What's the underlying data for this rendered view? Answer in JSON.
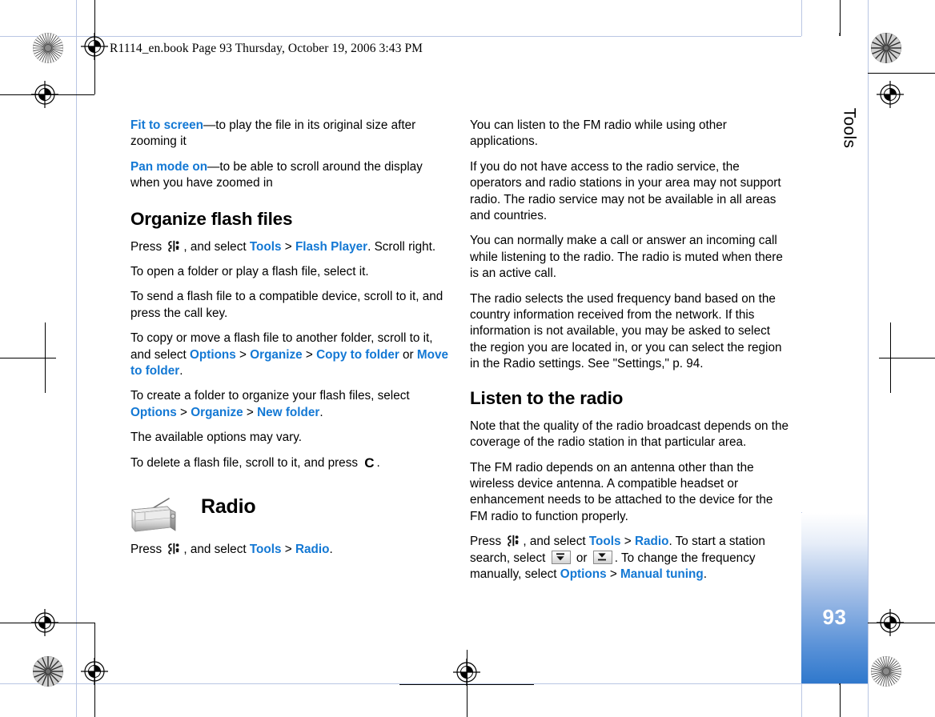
{
  "document": {
    "header_line": "R1114_en.book  Page 93  Thursday, October 19, 2006  3:43 PM",
    "page_number": "93",
    "section_tab": "Tools",
    "accent_color": "#1378d4",
    "page_tab_gradient_end": "#2f78cc"
  },
  "left_column": {
    "paragraphs": [
      {
        "id": "fit-to-screen",
        "segments": [
          {
            "type": "link",
            "text": "Fit to screen"
          },
          {
            "type": "text",
            "text": "—to play the file in its original size after zooming it"
          }
        ]
      },
      {
        "id": "pan-mode-on",
        "segments": [
          {
            "type": "link",
            "text": "Pan mode on"
          },
          {
            "type": "text",
            "text": "—to be able to scroll around the display when you have zoomed in"
          }
        ]
      }
    ],
    "heading_organize": "Organize flash files",
    "organize_paragraphs": [
      {
        "id": "press-tools-flash-player",
        "segments": [
          {
            "type": "text",
            "text": "Press "
          },
          {
            "type": "icon",
            "icon": "menu-key-icon"
          },
          {
            "type": "text",
            "text": ", and select "
          },
          {
            "type": "link",
            "text": "Tools"
          },
          {
            "type": "gt",
            "text": " > "
          },
          {
            "type": "link",
            "text": "Flash Player"
          },
          {
            "type": "text",
            "text": ". Scroll right."
          }
        ]
      },
      {
        "id": "open-folder",
        "segments": [
          {
            "type": "text",
            "text": "To open a folder or play a flash file, select it."
          }
        ]
      },
      {
        "id": "send-flash-file",
        "segments": [
          {
            "type": "text",
            "text": "To send a flash file to a compatible device, scroll to it, and press the call key."
          }
        ]
      },
      {
        "id": "copy-or-move",
        "segments": [
          {
            "type": "text",
            "text": "To copy or move a flash file to another folder, scroll to it, and select "
          },
          {
            "type": "link",
            "text": "Options"
          },
          {
            "type": "gt",
            "text": " > "
          },
          {
            "type": "link",
            "text": "Organize"
          },
          {
            "type": "gt",
            "text": " > "
          },
          {
            "type": "link",
            "text": "Copy to folder"
          },
          {
            "type": "text",
            "text": " or "
          },
          {
            "type": "link",
            "text": "Move to folder"
          },
          {
            "type": "text",
            "text": "."
          }
        ]
      },
      {
        "id": "create-folder",
        "segments": [
          {
            "type": "text",
            "text": "To create a folder to organize your flash files, select "
          },
          {
            "type": "link",
            "text": "Options"
          },
          {
            "type": "gt",
            "text": " > "
          },
          {
            "type": "link",
            "text": "Organize"
          },
          {
            "type": "gt",
            "text": " > "
          },
          {
            "type": "link",
            "text": "New folder"
          },
          {
            "type": "text",
            "text": "."
          }
        ]
      },
      {
        "id": "options-may-vary",
        "segments": [
          {
            "type": "text",
            "text": "The available options may vary."
          }
        ]
      },
      {
        "id": "delete-flash-file",
        "segments": [
          {
            "type": "text",
            "text": "To delete a flash file, scroll to it, and press "
          },
          {
            "type": "icon",
            "icon": "clear-key-icon",
            "glyph": "C"
          },
          {
            "type": "text",
            "text": "."
          }
        ]
      }
    ],
    "radio_section": {
      "icon": "radio-icon",
      "title": "Radio",
      "intro": {
        "id": "press-tools-radio",
        "segments": [
          {
            "type": "text",
            "text": "Press "
          },
          {
            "type": "icon",
            "icon": "menu-key-icon"
          },
          {
            "type": "text",
            "text": ", and select "
          },
          {
            "type": "link",
            "text": "Tools"
          },
          {
            "type": "gt",
            "text": " > "
          },
          {
            "type": "link",
            "text": "Radio"
          },
          {
            "type": "text",
            "text": "."
          }
        ]
      }
    }
  },
  "right_column": {
    "paragraphs": [
      {
        "id": "listen-while-other-apps",
        "segments": [
          {
            "type": "text",
            "text": "You can listen to the FM radio while using other applications."
          }
        ]
      },
      {
        "id": "no-access-radio-service",
        "segments": [
          {
            "type": "text",
            "text": "If you do not have access to the radio service, the operators and radio stations in your area may not support radio. The radio service may not be available in all areas and countries."
          }
        ]
      },
      {
        "id": "calls-while-listening",
        "segments": [
          {
            "type": "text",
            "text": "You can normally make a call or answer an incoming call while listening to the radio. The radio is muted when there is an active call."
          }
        ]
      },
      {
        "id": "frequency-band-region",
        "segments": [
          {
            "type": "text",
            "text": "The radio selects the used frequency band based on the country information received from the network. If this information is not available, you may be asked to select the region you are located in, or you can select the region in the Radio settings. See \"Settings,\" p. 94."
          }
        ]
      }
    ],
    "heading_listen": "Listen to the radio",
    "listen_paragraphs": [
      {
        "id": "broadcast-quality",
        "segments": [
          {
            "type": "text",
            "text": "Note that the quality of the radio broadcast depends on the coverage of the radio station in that particular area."
          }
        ]
      },
      {
        "id": "antenna-headset",
        "segments": [
          {
            "type": "text",
            "text": "The FM radio depends on an antenna other than the wireless device antenna. A compatible headset or enhancement needs to be attached to the device for the FM radio to function properly."
          }
        ]
      },
      {
        "id": "station-search",
        "segments": [
          {
            "type": "text",
            "text": "Press "
          },
          {
            "type": "icon",
            "icon": "menu-key-icon"
          },
          {
            "type": "text",
            "text": ", and select "
          },
          {
            "type": "link",
            "text": "Tools"
          },
          {
            "type": "gt",
            "text": " > "
          },
          {
            "type": "link",
            "text": "Radio"
          },
          {
            "type": "text",
            "text": ". To start a station search, select "
          },
          {
            "type": "icon",
            "icon": "scan-up-icon"
          },
          {
            "type": "text",
            "text": " or "
          },
          {
            "type": "icon",
            "icon": "scan-down-icon"
          },
          {
            "type": "text",
            "text": ". To change the frequency manually, select "
          },
          {
            "type": "link",
            "text": "Options"
          },
          {
            "type": "gt",
            "text": " > "
          },
          {
            "type": "link",
            "text": "Manual tuning"
          },
          {
            "type": "text",
            "text": "."
          }
        ]
      }
    ]
  }
}
